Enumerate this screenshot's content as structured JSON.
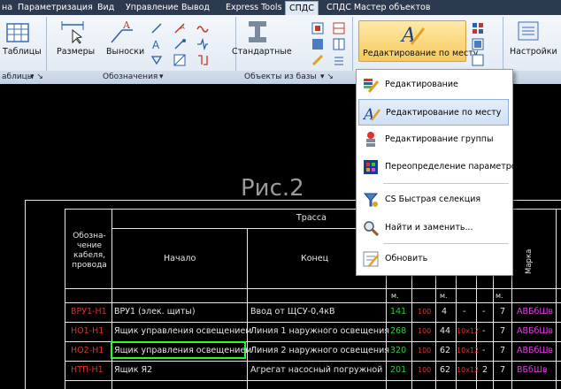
{
  "tabs": [
    "на",
    "Параметризация",
    "Вид",
    "Управление",
    "Вывод",
    "Express Tools",
    "СПДС",
    "СПДС Мастер объектов"
  ],
  "active_tab": "СПДС",
  "ribbon": {
    "tables_label": "Таблицы",
    "sizes_label": "Размеры",
    "callouts_label": "Выноски",
    "standard_label": "Стандартные",
    "edit_in_place_label": "Редактирование по месту",
    "settings_label": "Настройки",
    "panels": {
      "tables": "аблицы",
      "notations": "Обозначения",
      "objects_from_base": "Объекты из базы"
    }
  },
  "menu": {
    "items": [
      {
        "label": "Редактирование",
        "icon": "edit-icon"
      },
      {
        "label": "Редактирование по месту",
        "icon": "edit-in-place-icon"
      },
      {
        "label": "Редактирование группы",
        "icon": "edit-group-icon"
      },
      {
        "label": "Переопределение параметров",
        "icon": "override-params-icon"
      },
      {
        "label": "CS Быстрая селекция",
        "icon": "quick-select-icon"
      },
      {
        "label": "Найти и заменить...",
        "icon": "find-replace-icon"
      },
      {
        "label": "Обновить",
        "icon": "refresh-icon"
      }
    ]
  },
  "drawing": {
    "caption": "Рис.2",
    "headers": {
      "designation": [
        "Обозна-",
        "чение",
        "кабеля,",
        "провода"
      ],
      "route": "Трасса",
      "start": "Начало",
      "end": "Конец",
      "mark": "Марка",
      "unit_m": "м."
    },
    "rows": [
      {
        "id": "ВРУ1-Н1",
        "start": "ВРУ1 (элек. щиты)",
        "end": "Ввод от ЩСУ-0,4кВ",
        "len": "141",
        "v1": "100",
        "v2": "4",
        "v3": "-",
        "v4": "-",
        "v5": "7",
        "mark": "АВБбШв"
      },
      {
        "id": "НО1-Н1",
        "start": "Ящик управления освещением",
        "end": "Линия 1 наружного освещения",
        "len": "268",
        "v1": "100",
        "v2": "44",
        "v3": "10х12",
        "v4": "-",
        "v5": "7",
        "mark": "АВБбШв"
      },
      {
        "id": "НО2-Н1",
        "start": "Ящик управления освещением",
        "end": "Линия 2 наружного освещения",
        "len": "320",
        "v1": "100",
        "v2": "62",
        "v3": "10х12",
        "v4": "-",
        "v5": "7",
        "mark": "АВБбШв"
      },
      {
        "id": "НТП-Н1",
        "start": "Ящик Я2",
        "end": "Агрегат насосный погружной",
        "len": "201",
        "v1": "100",
        "v2": "62",
        "v3": "10х12",
        "v4": "2",
        "v5": "7",
        "mark": "ВБбШв"
      }
    ]
  },
  "colors": {
    "tab_bg": "#2b3a4f",
    "ribbon_bg": "#e4ecf5",
    "highlight": "#f7c95c",
    "red_text": "#e03030",
    "green_text": "#2ecc40",
    "magenta_text": "#e040e0",
    "selection": "#22ff22"
  }
}
